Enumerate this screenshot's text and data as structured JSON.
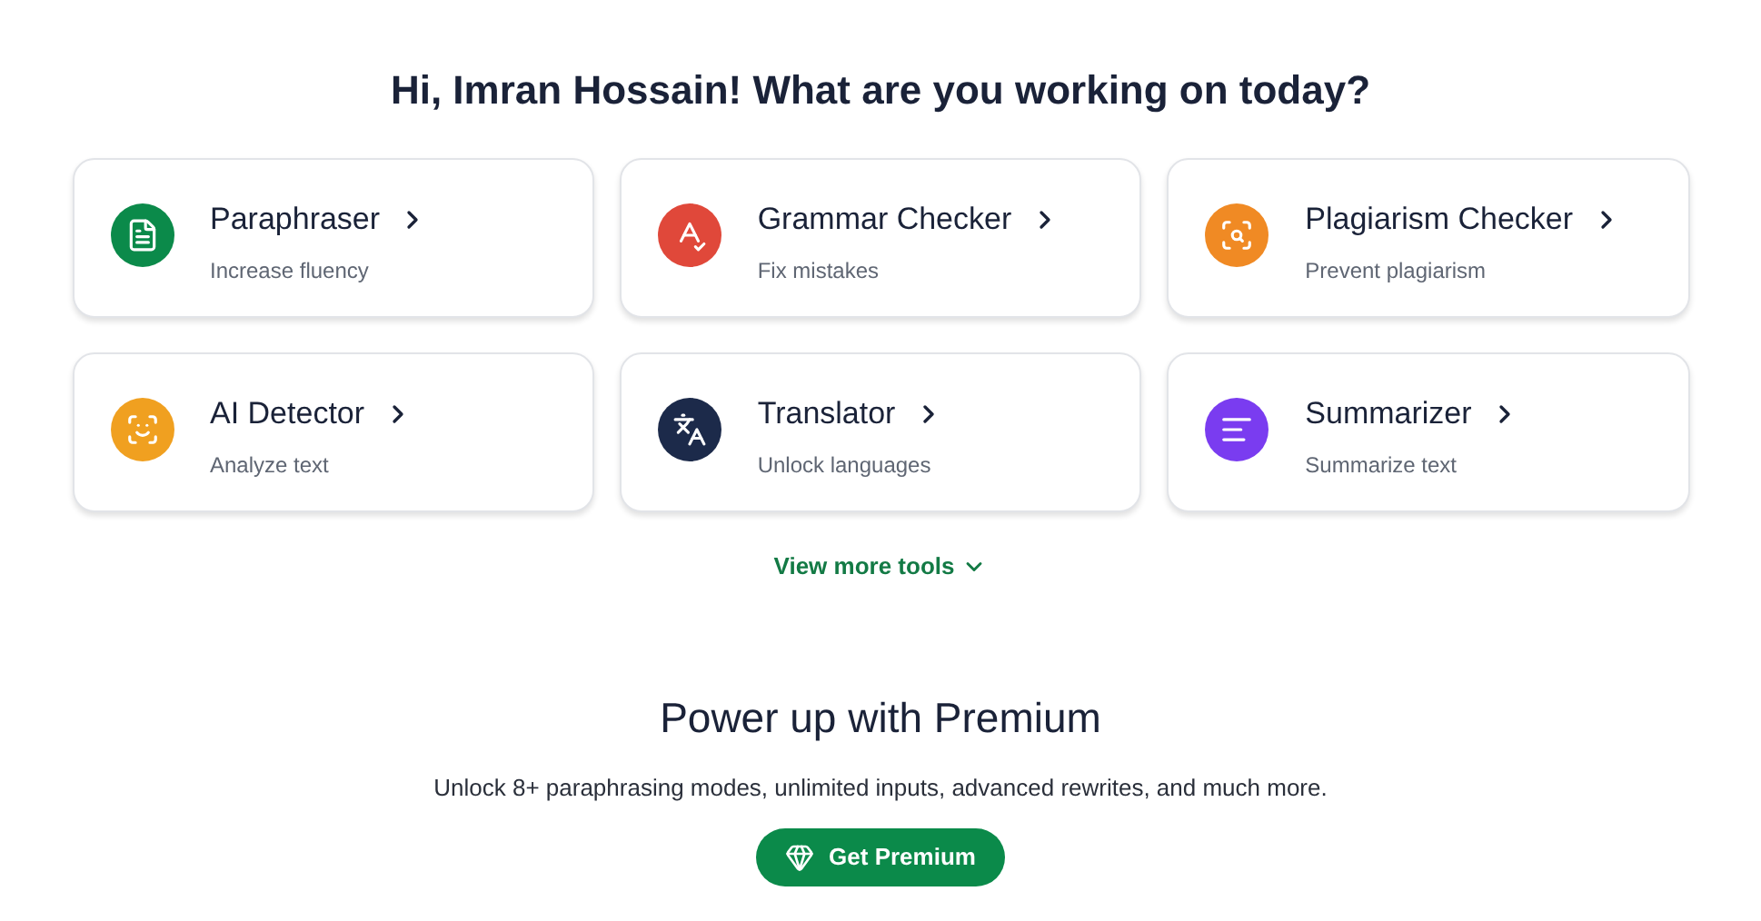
{
  "greeting": "Hi, Imran Hossain! What are you working on today?",
  "tools": [
    {
      "kind": "paraphraser",
      "name": "Paraphraser",
      "description": "Increase fluency",
      "color": "#0b8a4a"
    },
    {
      "kind": "grammar",
      "name": "Grammar Checker",
      "description": "Fix mistakes",
      "color": "#e0483a"
    },
    {
      "kind": "plagiarism",
      "name": "Plagiarism Checker",
      "description": "Prevent plagiarism",
      "color": "#f08a24"
    },
    {
      "kind": "detector",
      "name": "AI Detector",
      "description": "Analyze text",
      "color": "#f0a020"
    },
    {
      "kind": "translator",
      "name": "Translator",
      "description": "Unlock languages",
      "color": "#1c2a4a"
    },
    {
      "kind": "summarizer",
      "name": "Summarizer",
      "description": "Summarize text",
      "color": "#7a3cf0"
    }
  ],
  "more_link": "View more tools",
  "premium": {
    "title": "Power up with Premium",
    "text": "Unlock 8+ paraphrasing modes, unlimited inputs, advanced rewrites, and much more.",
    "button": "Get Premium"
  }
}
